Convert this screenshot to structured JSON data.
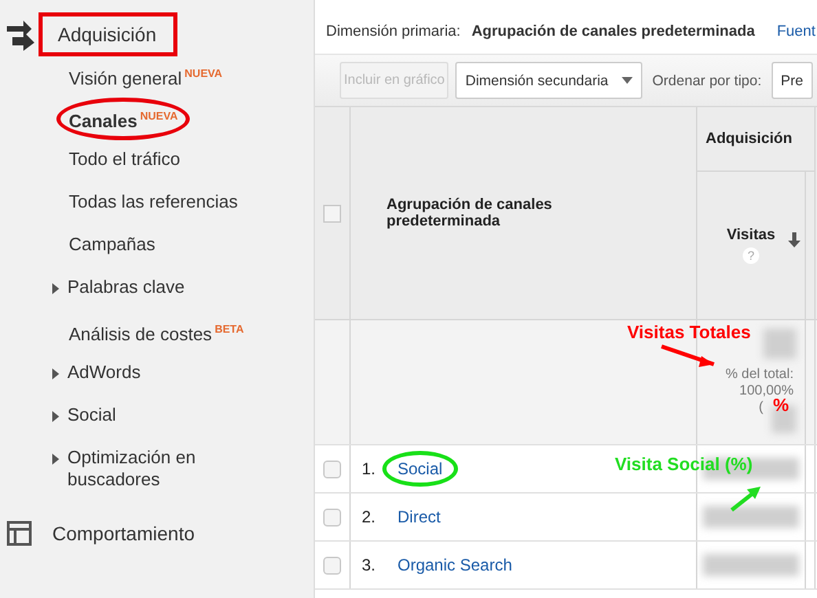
{
  "sidebar": {
    "sections": [
      {
        "label": "Adquisición",
        "boxed": true,
        "items": [
          {
            "label": "Visión general",
            "badge": "NUEVA",
            "selected": false,
            "expandable": false,
            "circled": false
          },
          {
            "label": "Canales",
            "badge": "NUEVA",
            "selected": true,
            "expandable": false,
            "circled": true
          },
          {
            "label": "Todo el tráfico",
            "selected": false,
            "expandable": false,
            "circled": false
          },
          {
            "label": "Todas las referencias",
            "selected": false,
            "expandable": false,
            "circled": false
          },
          {
            "label": "Campañas",
            "selected": false,
            "expandable": false,
            "circled": false
          },
          {
            "label": "Palabras clave",
            "selected": false,
            "expandable": true,
            "circled": false
          },
          {
            "label": "Análisis de costes",
            "badge": "BETA",
            "selected": false,
            "expandable": false,
            "circled": false
          },
          {
            "label": "AdWords",
            "selected": false,
            "expandable": true,
            "circled": false
          },
          {
            "label": "Social",
            "selected": false,
            "expandable": true,
            "circled": false
          },
          {
            "label": "Optimización en buscadores",
            "selected": false,
            "expandable": true,
            "circled": false
          }
        ]
      },
      {
        "label": "Comportamiento",
        "boxed": false
      }
    ]
  },
  "report": {
    "primary_dimension_label": "Dimensión primaria:",
    "primary_dimension_value": "Agrupación de canales predeterminada",
    "primary_dimension_link": "Fuent",
    "toolbar": {
      "plot_button": {
        "label": "Incluir en gráfico",
        "disabled": true
      },
      "secondary_dimension": "Dimensión secundaria",
      "sort_label": "Ordenar por tipo:",
      "sort_value": "Pre"
    },
    "table": {
      "select_all_checked": false,
      "group_header": "Adquisición",
      "dimension_column": "Agrupación de canales predeterminada",
      "metric_column": {
        "label": "Visitas",
        "help": "?",
        "sorted": true
      },
      "totals": {
        "label": "% del total:",
        "value": "100,00%",
        "extra": "("
      },
      "rows": [
        {
          "number": "1.",
          "label": "Social",
          "checked": false,
          "circled": true
        },
        {
          "number": "2.",
          "label": "Direct",
          "checked": false,
          "circled": false
        },
        {
          "number": "3.",
          "label": "Organic Search",
          "checked": false,
          "circled": false
        }
      ]
    }
  },
  "annotations": [
    {
      "text": "Visitas Totales",
      "color": "#ff0000",
      "arrow": true
    },
    {
      "text": "%",
      "color": "#ff0000",
      "arrow": false
    },
    {
      "text": "Visita Social (%)",
      "color": "#22dd22",
      "arrow": true
    }
  ]
}
